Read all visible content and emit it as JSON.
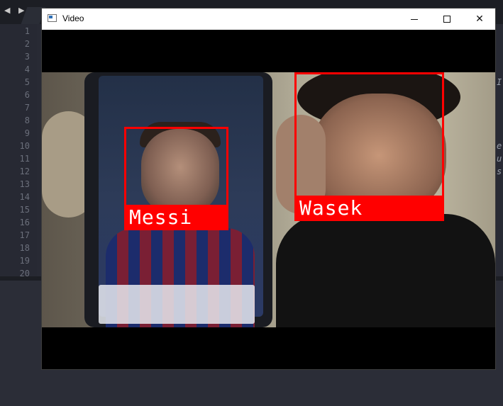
{
  "editor": {
    "nav_arrows": "◀ ▶",
    "line_numbers": [
      "1",
      "2",
      "3",
      "4",
      "5",
      "6",
      "7",
      "8",
      "9",
      "10",
      "11",
      "12",
      "13",
      "14",
      "15",
      "16",
      "17",
      "18",
      "19",
      "20"
    ],
    "right_edge_chars": [
      "I",
      "e",
      "u",
      "s"
    ]
  },
  "window": {
    "title": "Video",
    "controls": {
      "minimize": "minimize",
      "maximize": "maximize",
      "close": "✕"
    }
  },
  "detections": [
    {
      "name": "Messi",
      "color": "#ff0000"
    },
    {
      "name": "Wasek",
      "color": "#ff0000"
    }
  ],
  "colors": {
    "accent": "#ff0000",
    "titlebar": "#ffffff",
    "editor_bg": "#282a34"
  }
}
